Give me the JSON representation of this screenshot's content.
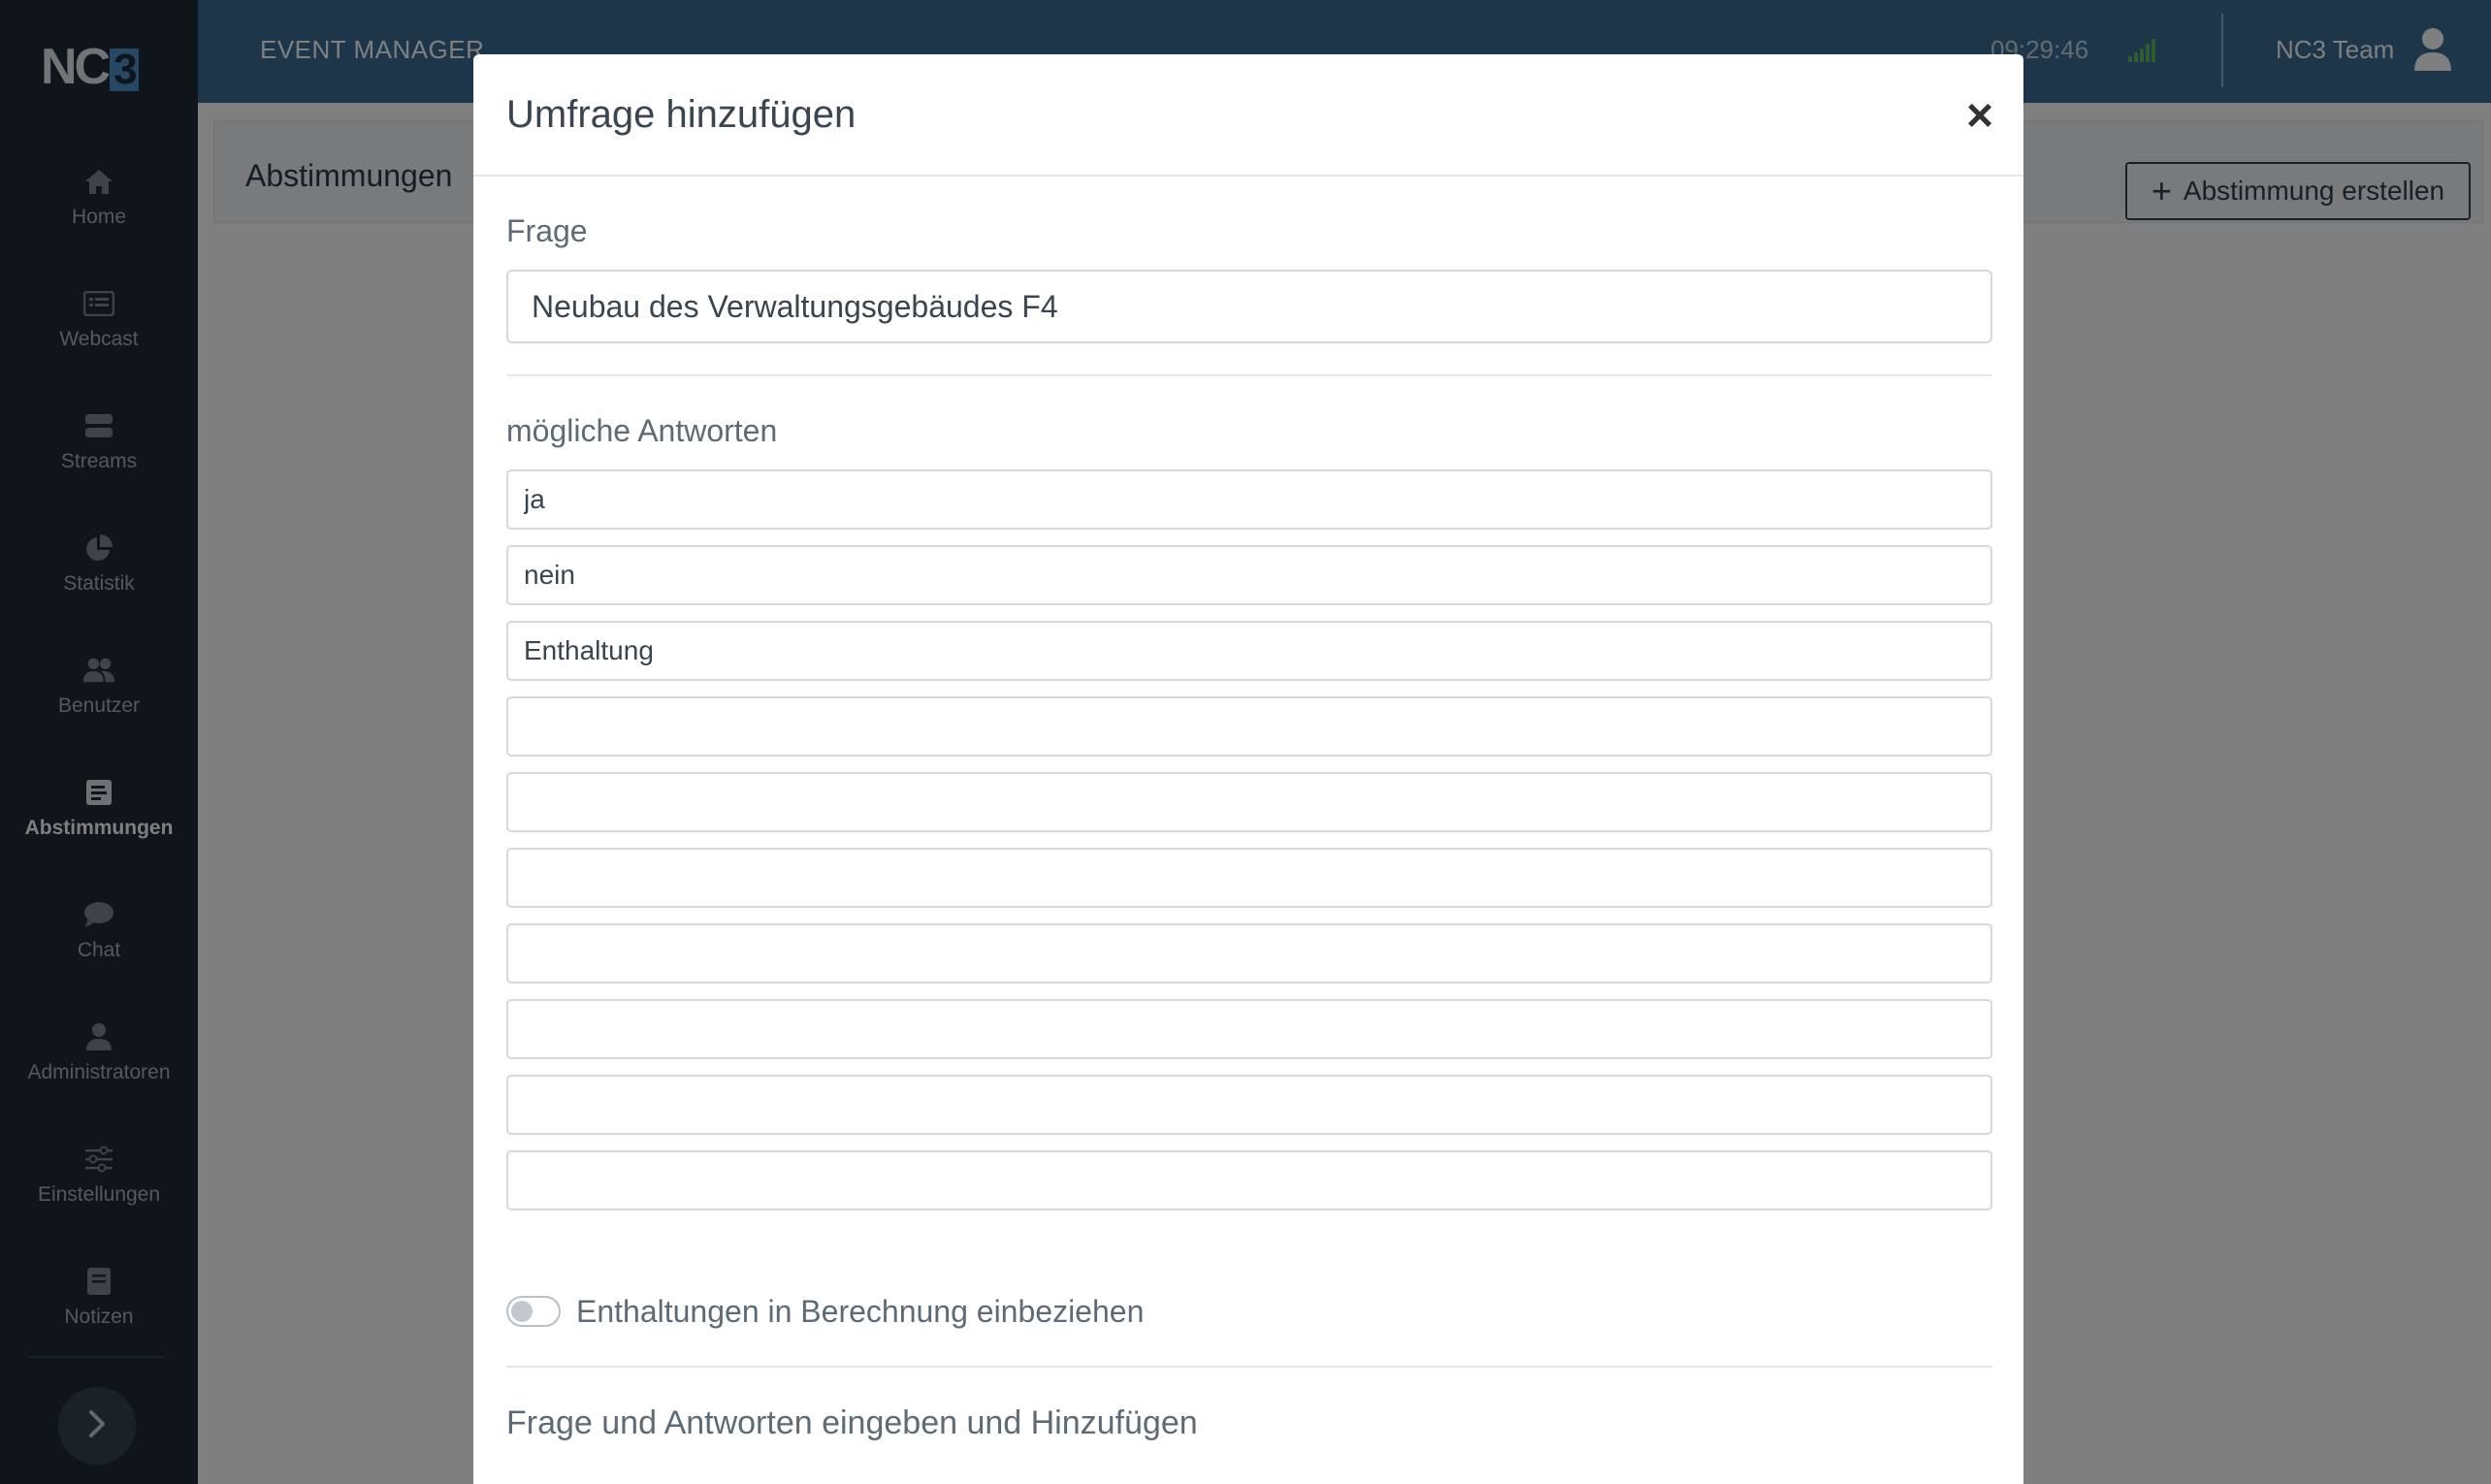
{
  "sidebar": {
    "logo": "NC3",
    "items": [
      {
        "label": "Home",
        "icon": "home-icon"
      },
      {
        "label": "Webcast",
        "icon": "webcast-icon"
      },
      {
        "label": "Streams",
        "icon": "streams-icon"
      },
      {
        "label": "Statistik",
        "icon": "pie-chart-icon"
      },
      {
        "label": "Benutzer",
        "icon": "users-icon"
      },
      {
        "label": "Abstimmungen",
        "icon": "poll-icon",
        "active": true
      },
      {
        "label": "Chat",
        "icon": "chat-icon"
      },
      {
        "label": "Administratoren",
        "icon": "admin-icon"
      },
      {
        "label": "Einstellungen",
        "icon": "sliders-icon"
      },
      {
        "label": "Notizen",
        "icon": "notes-icon"
      }
    ],
    "expand_icon": "chevron-right-icon"
  },
  "header": {
    "title": "EVENT MANAGER",
    "time": "09:29:46",
    "signal_icon": "signal-icon",
    "user_name": "NC3 Team",
    "user_icon": "user-icon"
  },
  "main": {
    "title": "Abstimmungen",
    "create_button": {
      "plus": "+",
      "label": "Abstimmung erstellen"
    }
  },
  "modal": {
    "title": "Umfrage hinzufügen",
    "close_label": "×",
    "question_label": "Frage",
    "question_value": "Neubau des Verwaltungsgebäudes F4",
    "answers_label": "mögliche Antworten",
    "answers": [
      "ja",
      "nein",
      "Enthaltung",
      "",
      "",
      "",
      "",
      "",
      "",
      ""
    ],
    "toggle_label": "Enthaltungen in Berechnung einbeziehen",
    "toggle_on": false,
    "hint": "Frage und Antworten eingeben und Hinzufügen"
  },
  "colors": {
    "sidebar_bg": "#1f2b37",
    "header_bg": "#3a6d94",
    "signal_green": "#5cb85c"
  }
}
